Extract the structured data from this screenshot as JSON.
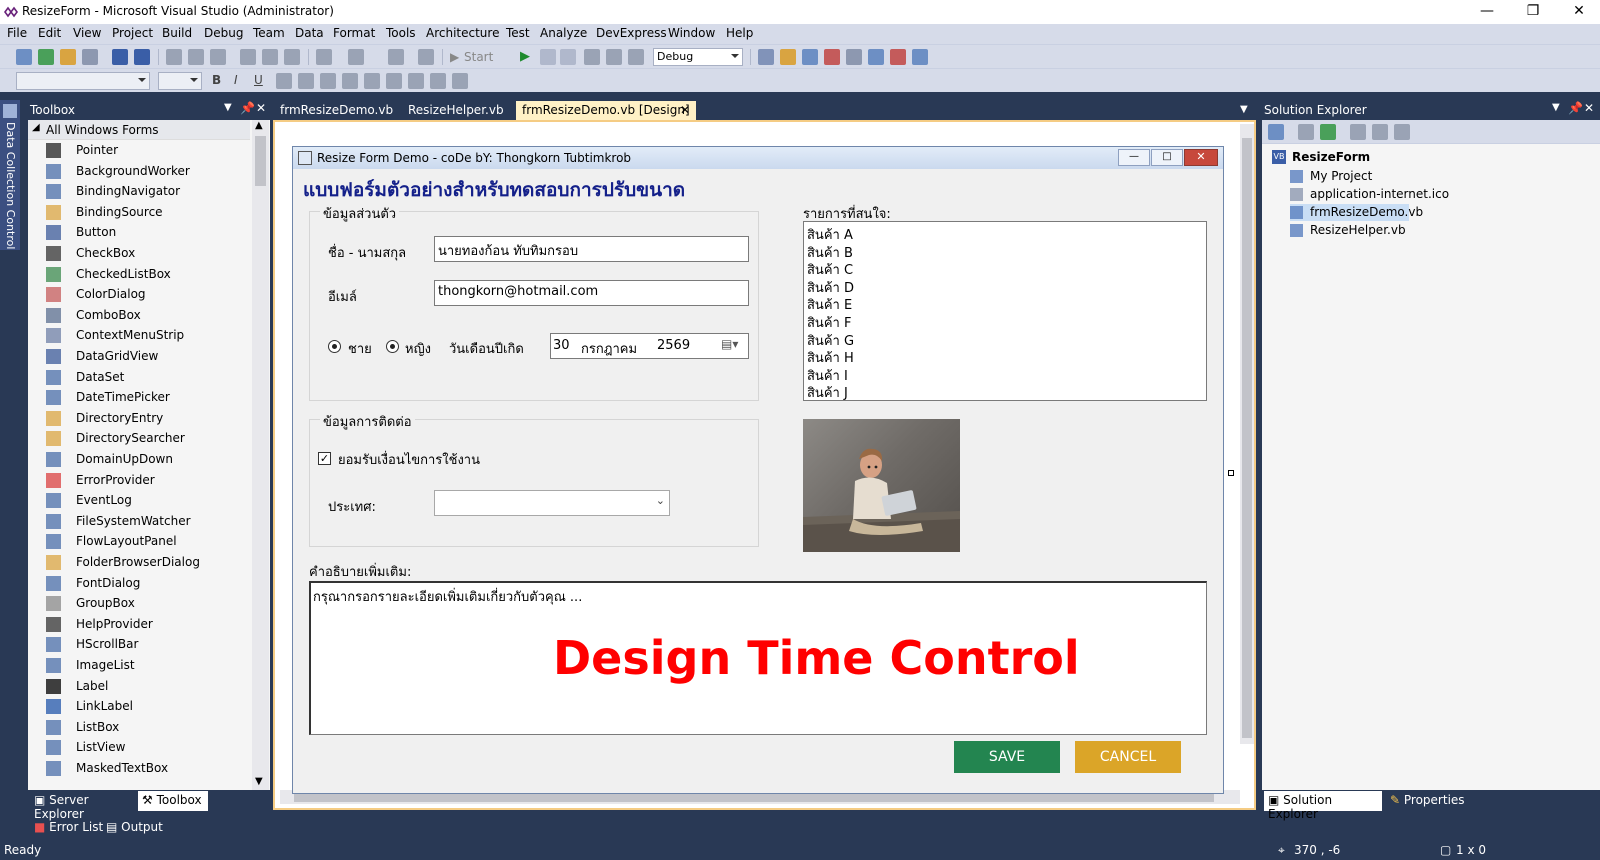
{
  "window": {
    "title": "ResizeForm - Microsoft Visual Studio (Administrator)"
  },
  "menu": [
    "File",
    "Edit",
    "View",
    "Project",
    "Build",
    "Debug",
    "Team",
    "Data",
    "Format",
    "Tools",
    "Architecture",
    "Test",
    "Analyze",
    "DevExpress",
    "Window",
    "Help"
  ],
  "toolbar": {
    "start_label": "Start",
    "config_value": "Debug"
  },
  "side_strip": {
    "label": "Data Collection Control"
  },
  "toolbox": {
    "title": "Toolbox",
    "group": "All Windows Forms",
    "items": [
      "Pointer",
      "BackgroundWorker",
      "BindingNavigator",
      "BindingSource",
      "Button",
      "CheckBox",
      "CheckedListBox",
      "ColorDialog",
      "ComboBox",
      "ContextMenuStrip",
      "DataGridView",
      "DataSet",
      "DateTimePicker",
      "DirectoryEntry",
      "DirectorySearcher",
      "DomainUpDown",
      "ErrorProvider",
      "EventLog",
      "FileSystemWatcher",
      "FlowLayoutPanel",
      "FolderBrowserDialog",
      "FontDialog",
      "GroupBox",
      "HelpProvider",
      "HScrollBar",
      "ImageList",
      "Label",
      "LinkLabel",
      "ListBox",
      "ListView",
      "MaskedTextBox"
    ]
  },
  "tabs": [
    {
      "label": "frmResizeDemo.vb"
    },
    {
      "label": "ResizeHelper.vb"
    },
    {
      "label": "frmResizeDemo.vb [Design]"
    }
  ],
  "form": {
    "title": "Resize Form Demo - coDe bY: Thongkorn Tubtimkrob",
    "heading": "แบบฟอร์มตัวอย่างสำหรับทดสอบการปรับขนาด",
    "personal_group": "ข้อมูลส่วนตัว",
    "name_label": "ชื่อ - นามสกุล",
    "name_value": "นายทองก้อน ทับทิมกรอบ",
    "email_label": "อีเมล์",
    "email_value": "thongkorn@hotmail.com",
    "male_label": "ชาย",
    "female_label": "หญิง",
    "birth_label": "วันเดือนปีเกิด",
    "date_day": "30",
    "date_month": "กรกฎาคม",
    "date_year": "2569",
    "contact_group": "ข้อมูลการติดต่อ",
    "accept_label": "ยอมรับเงื่อนไขการใช้งาน",
    "country_label": "ประเทศ:",
    "country_value": "",
    "interests_label": "รายการที่สนใจ:",
    "interests": [
      "สินค้า A",
      "สินค้า B",
      "สินค้า C",
      "สินค้า D",
      "สินค้า E",
      "สินค้า F",
      "สินค้า G",
      "สินค้า H",
      "สินค้า I",
      "สินค้า J"
    ],
    "desc_label": "คำอธิบายเพิ่มเติม:",
    "desc_value": "กรุณากรอกรายละเอียดเพิ่มเติมเกี่ยวกับตัวคุณ ...",
    "overlay_text": "Design Time Control",
    "save_label": "SAVE",
    "cancel_label": "CANCEL"
  },
  "solution_explorer": {
    "title": "Solution Explorer",
    "project": "ResizeForm",
    "items": [
      "My Project",
      "application-internet.ico",
      "frmResizeDemo.vb",
      "ResizeHelper.vb"
    ]
  },
  "bottom_tabs_left": [
    "Server Explorer",
    "Toolbox"
  ],
  "bottom_tabs_right": [
    "Solution Explorer",
    "Properties"
  ],
  "bottom_bar": [
    "Error List",
    "Output"
  ],
  "status": {
    "text": "Ready",
    "position": "370 , -6",
    "size": "1 x 0"
  },
  "colors": {
    "accent_frame": "#293955",
    "save_button": "#238550",
    "cancel_button": "#dba528",
    "overlay_red": "#ff0000"
  }
}
